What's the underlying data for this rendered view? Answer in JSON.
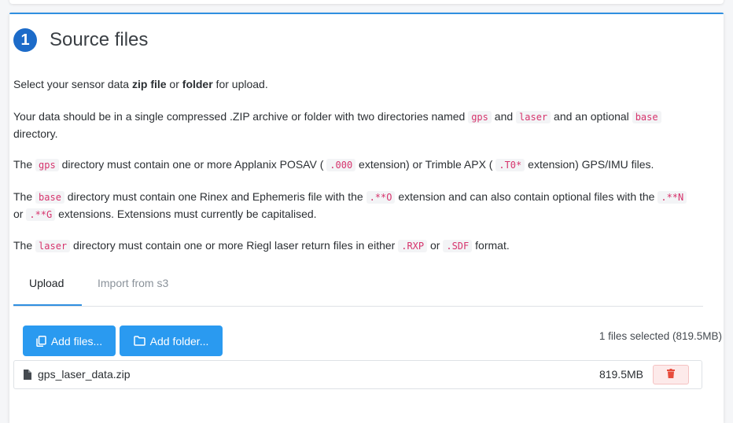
{
  "step": {
    "number": "1",
    "title": "Source files"
  },
  "intro": {
    "pre": "Select your sensor data ",
    "b1": "zip file",
    "mid": " or ",
    "b2": "folder",
    "post": " for upload."
  },
  "p2": {
    "t1": "Your data should be in a single compressed .ZIP archive or folder with two directories named ",
    "c1": "gps",
    "t2": " and ",
    "c2": "laser",
    "t3": " and an optional ",
    "c3": "base",
    "t4": " directory."
  },
  "p3": {
    "t1": "The ",
    "c1": "gps",
    "t2": " directory must contain one or more Applanix POSAV ( ",
    "c2": ".000",
    "t3": " extension) or Trimble APX ( ",
    "c3": ".T0*",
    "t4": " extension) GPS/IMU files."
  },
  "p4": {
    "t1": "The ",
    "c1": "base",
    "t2": " directory must contain one Rinex and Ephemeris file with the ",
    "c2": ".**O",
    "t3": " extension and can also contain optional files with the ",
    "c3": ".**N",
    "t4": " or ",
    "c4": ".**G",
    "t5": " extensions. Extensions must currently be capitalised."
  },
  "p5": {
    "t1": "The ",
    "c1": "laser",
    "t2": " directory must contain one or more Riegl laser return files in either ",
    "c2": ".RXP",
    "t3": " or ",
    "c3": ".SDF",
    "t4": " format."
  },
  "tabs": [
    {
      "label": "Upload",
      "active": true
    },
    {
      "label": "Import from s3",
      "active": false
    }
  ],
  "buttons": {
    "add_files": "Add files...",
    "add_folder": "Add folder..."
  },
  "selection_status": "1 files selected (819.5MB)",
  "files": [
    {
      "name": "gps_laser_data.zip",
      "size": "819.5MB"
    }
  ],
  "colors": {
    "accent": "#2f8fe0",
    "button": "#2a9af0",
    "badge": "#1c6bc9",
    "code": "#d6336c",
    "danger": "#e74c3c"
  },
  "icons": {
    "add_files": "copy-icon",
    "add_folder": "folder-icon",
    "file": "file-icon",
    "delete": "trash-icon"
  }
}
